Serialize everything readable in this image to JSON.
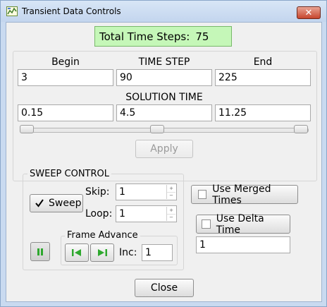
{
  "window": {
    "title": "Transient Data Controls",
    "close_glyph": "✕"
  },
  "total_time_steps": {
    "label": "Total Time Steps:",
    "value": "75"
  },
  "range": {
    "begin_label": "Begin",
    "time_step_label": "TIME STEP",
    "end_label": "End",
    "begin_step": "3",
    "current_step": "90",
    "end_step": "225",
    "solution_time_label": "SOLUTION TIME",
    "begin_time": "0.15",
    "current_time": "4.5",
    "end_time": "11.25",
    "apply_label": "Apply"
  },
  "sweep": {
    "group_label": "SWEEP CONTROL",
    "sweep_label": "Sweep",
    "sweep_checked": true,
    "skip_label": "Skip:",
    "skip_value": "1",
    "loop_label": "Loop:",
    "loop_value": "1",
    "frame_advance_label": "Frame Advance",
    "inc_label": "Inc:",
    "inc_value": "1"
  },
  "options": {
    "use_merged_times_label": "Use Merged Times",
    "use_merged_times_checked": false,
    "use_delta_time_label": "Use Delta Time",
    "use_delta_time_checked": false,
    "delta_time_value": "1"
  },
  "footer": {
    "close_label": "Close"
  },
  "icons": {
    "app": "app-grid-icon",
    "pause": "pause-icon",
    "step_back": "step-back-icon",
    "step_forward": "step-forward-icon"
  },
  "colors": {
    "total_bg": "#c5f7b8",
    "play_green": "#2ea82e",
    "close_red": "#c7452d"
  }
}
